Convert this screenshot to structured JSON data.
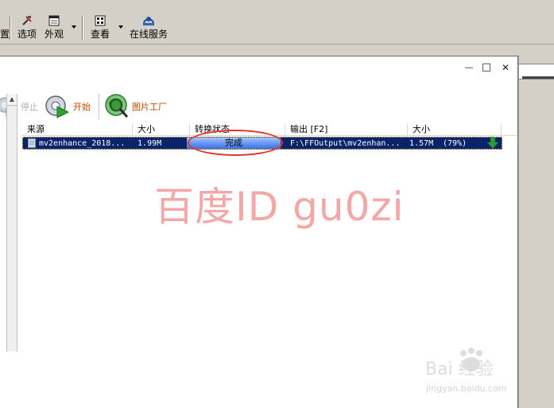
{
  "toolbar": {
    "edge_fragment": "置",
    "options_label": "选项",
    "appearance_label": "外观",
    "view_label": "查看",
    "online_label": "在线服务"
  },
  "dialog": {
    "minimize": "—",
    "maximize": "□",
    "close": "✕",
    "toolbar": {
      "stop_label": "停止",
      "start_label": "开始",
      "picture_label": "图片工厂"
    },
    "columns": {
      "source": "来源",
      "size": "大小",
      "status": "转换状态",
      "output": "输出 [F2]",
      "out_size": "大小"
    },
    "rows": [
      {
        "source": "mv2enhance_2018...",
        "size": "1.99M",
        "status": "完成",
        "output": "F:\\FFOutput\\mv2enhan...",
        "out_size": "1.57M",
        "ratio": "(79%)"
      }
    ]
  },
  "watermark": "百度ID gu0zi",
  "baidu": {
    "brand": "Bai  经验",
    "url": "jingyan.baidu.com"
  },
  "colors": {
    "selected_row": "#0a246a",
    "status_bar": "#5d8ef0",
    "annotation": "#e0342a",
    "watermark": "#f4a7a7",
    "download_arrow": "#2e9a2e"
  }
}
